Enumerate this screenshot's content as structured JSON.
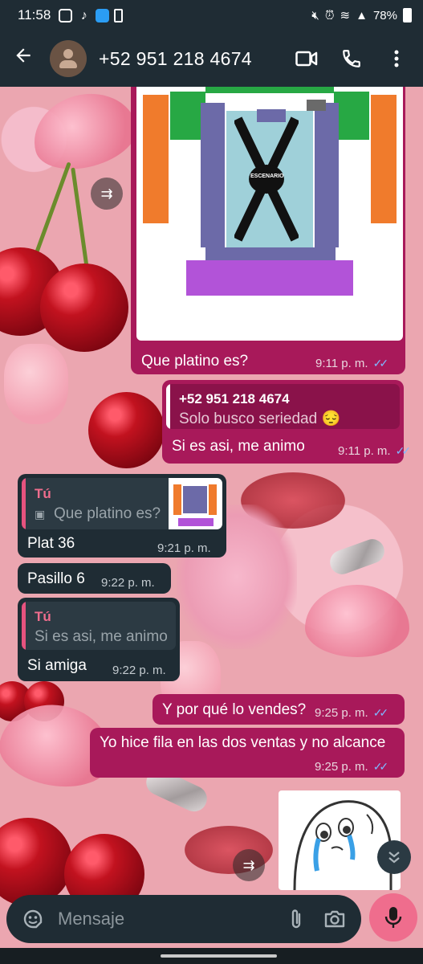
{
  "status": {
    "time": "11:58",
    "battery": "78%"
  },
  "header": {
    "contact": "+52 951 218 4674"
  },
  "seatmap": {
    "stage": "ESCENARIO"
  },
  "messages": [
    {
      "id": "m1",
      "text": "Que platino es?",
      "time": "9:11 p. m."
    },
    {
      "id": "m2",
      "quote_name": "+52 951 218 4674",
      "quote_text": "Solo busco seriedad 😔",
      "text": "Si es asi, me animo",
      "time": "9:11 p. m."
    },
    {
      "id": "m3",
      "quote_name": "Tú",
      "quote_text": "Que platino es?",
      "text": "Plat 36",
      "time": "9:21 p. m."
    },
    {
      "id": "m4",
      "text": "Pasillo 6",
      "time": "9:22 p. m."
    },
    {
      "id": "m5",
      "quote_name": "Tú",
      "quote_text": "Si es asi, me animo",
      "text": "Si amiga",
      "time": "9:22 p. m."
    },
    {
      "id": "m6",
      "text": "Y por qué lo vendes?",
      "time": "9:25 p. m."
    },
    {
      "id": "m7",
      "text": "Yo hice fila en las dos ventas y no alcance",
      "time": "9:25 p. m."
    }
  ],
  "input": {
    "placeholder": "Mensaje"
  },
  "colors": {
    "outgoing": "#a8195a",
    "incoming": "#1f2c34",
    "header": "#1f2c34",
    "mic": "#ef6d8d"
  }
}
